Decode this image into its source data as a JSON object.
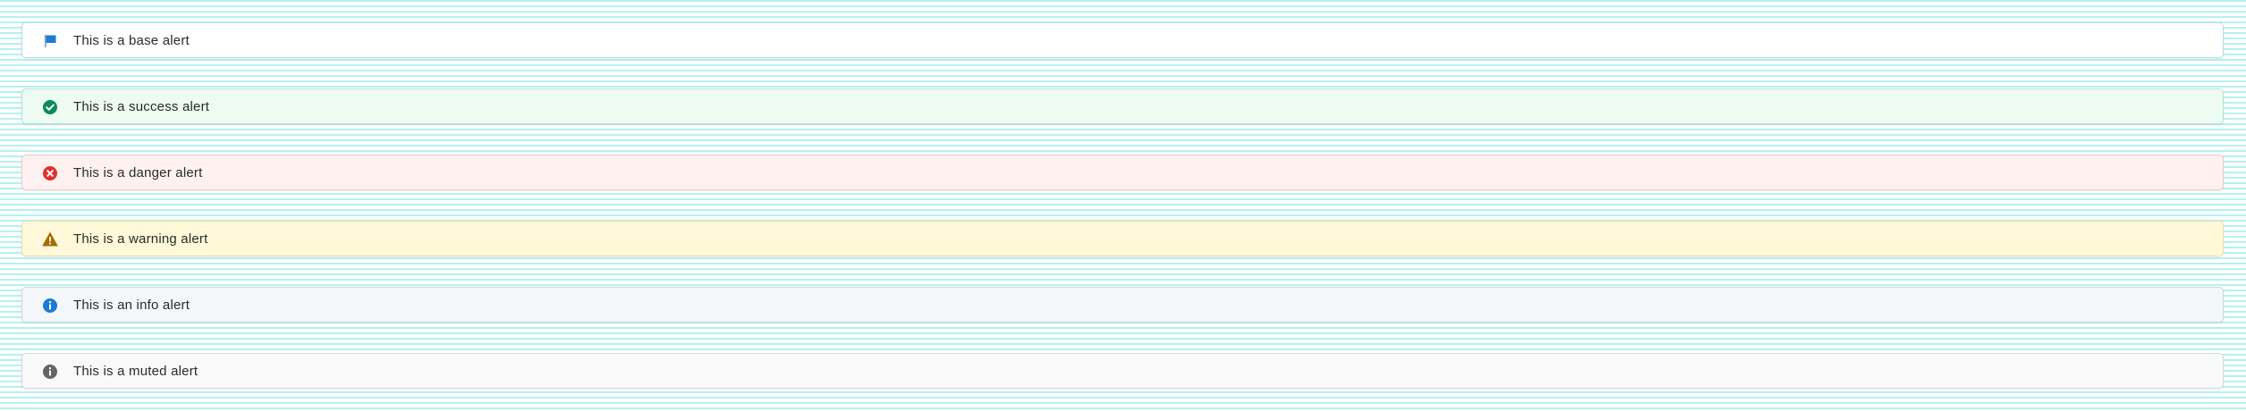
{
  "alerts": {
    "base": {
      "text": "This is a base alert",
      "icon": "flag-icon",
      "icon_color": "#1f7ad6",
      "background": "#ffffff"
    },
    "success": {
      "text": "This is a success alert",
      "icon": "check-circle-icon",
      "icon_color": "#0b8a5a",
      "background": "#edfbf3"
    },
    "danger": {
      "text": "This is a danger alert",
      "icon": "x-circle-icon",
      "icon_color": "#e0302e",
      "background": "#fff1f0"
    },
    "warning": {
      "text": "This is a warning alert",
      "icon": "warning-triangle-icon",
      "icon_color": "#a86b00",
      "background": "#fff8d9"
    },
    "info": {
      "text": "This is an info alert",
      "icon": "info-circle-icon",
      "icon_color": "#1f7ad6",
      "background": "#f3f7fa"
    },
    "muted": {
      "text": "This is a muted alert",
      "icon": "info-circle-muted-icon",
      "icon_color": "#666666",
      "background": "#f9f9f9"
    }
  }
}
